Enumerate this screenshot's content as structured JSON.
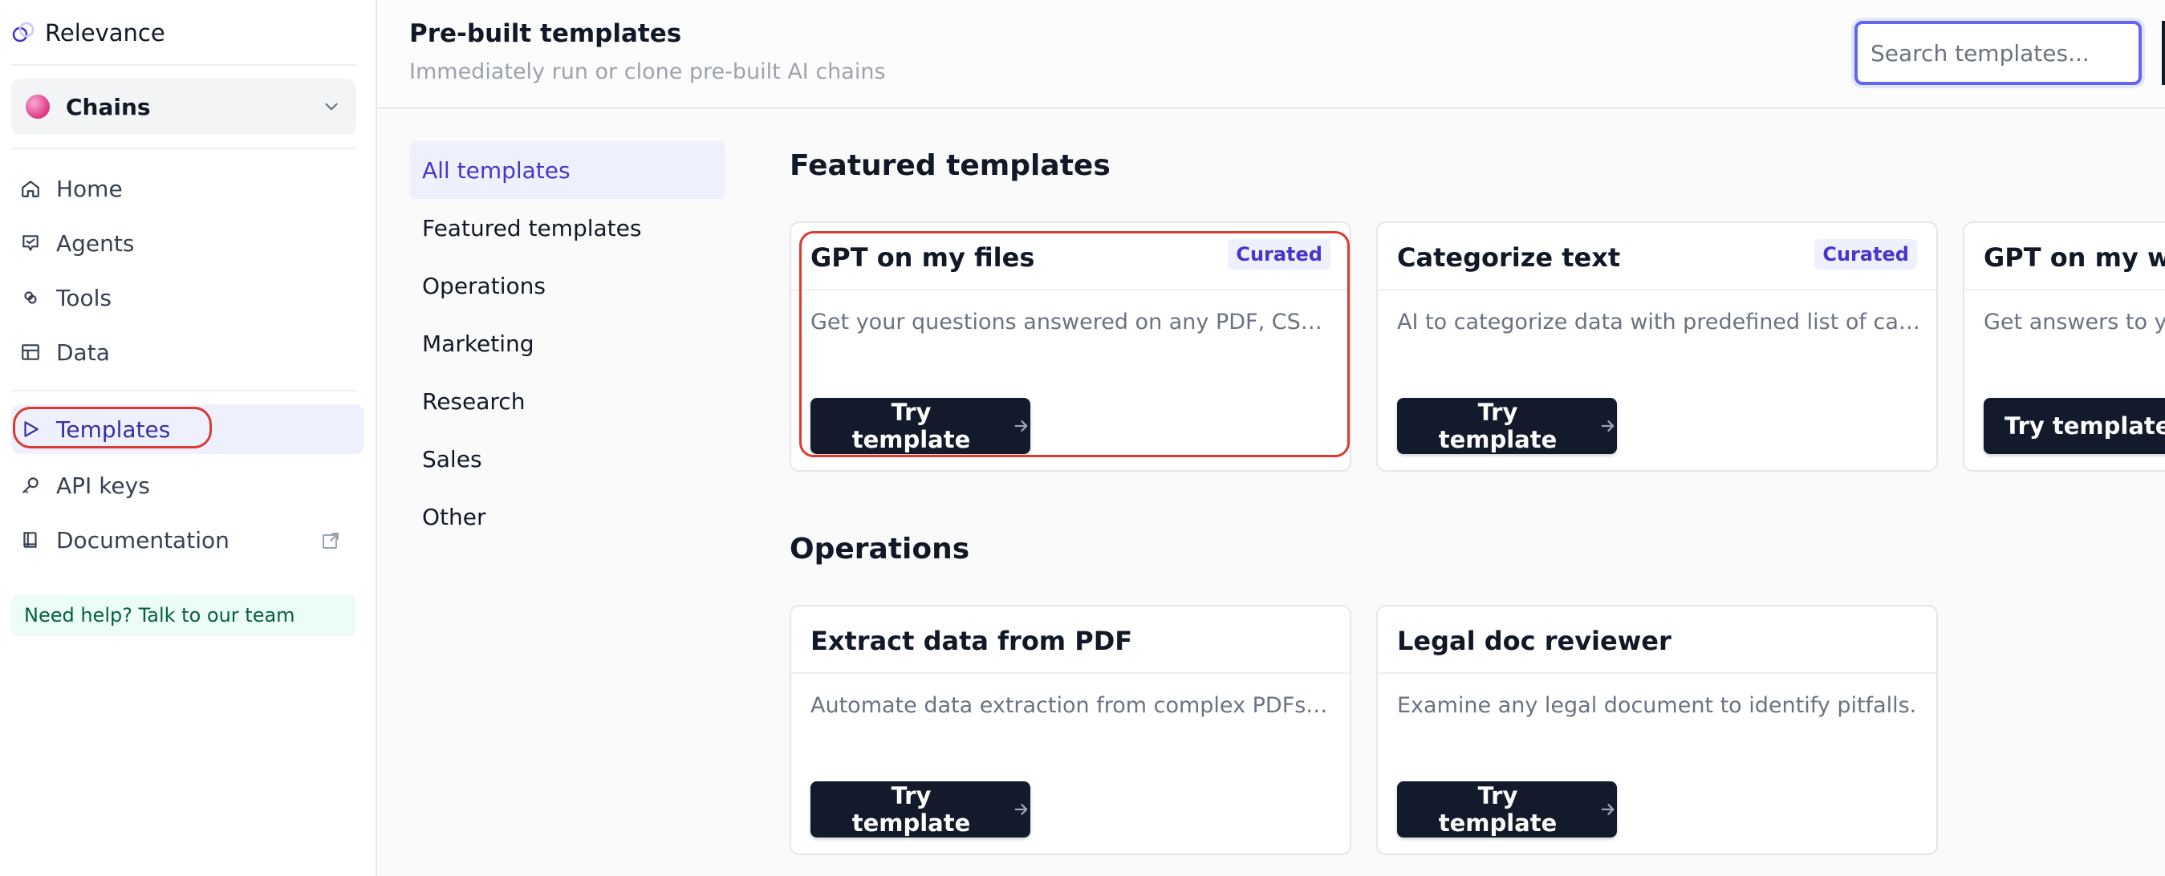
{
  "brand": {
    "name": "Relevance"
  },
  "workspace": {
    "name": "Chains"
  },
  "sidebar": {
    "items": [
      {
        "label": "Home",
        "icon": "home-icon"
      },
      {
        "label": "Agents",
        "icon": "agent-icon"
      },
      {
        "label": "Tools",
        "icon": "tools-icon"
      },
      {
        "label": "Data",
        "icon": "table-icon"
      },
      {
        "label": "Templates",
        "icon": "play-icon",
        "active": true
      },
      {
        "label": "API keys",
        "icon": "key-icon"
      },
      {
        "label": "Documentation",
        "icon": "book-icon",
        "external": true
      }
    ],
    "help": "Need help? Talk to our team"
  },
  "header": {
    "title": "Pre-built templates",
    "subtitle": "Immediately run or clone pre-built AI chains",
    "search_placeholder": "Search templates..."
  },
  "categories": [
    {
      "label": "All templates",
      "active": true
    },
    {
      "label": "Featured templates"
    },
    {
      "label": "Operations"
    },
    {
      "label": "Marketing"
    },
    {
      "label": "Research"
    },
    {
      "label": "Sales"
    },
    {
      "label": "Other"
    }
  ],
  "sections": [
    {
      "title": "Featured templates",
      "cards": [
        {
          "title": "GPT on my files",
          "badge": "Curated",
          "description": "Get your questions answered on any PDF, CSV, ...",
          "button": "Try template"
        },
        {
          "title": "Categorize text",
          "badge": "Curated",
          "description": "AI to categorize data with predefined list of cat...",
          "button": "Try template"
        },
        {
          "title": "GPT on my web",
          "badge": "",
          "description": "Get answers to yo",
          "button": "Try template"
        }
      ]
    },
    {
      "title": "Operations",
      "cards": [
        {
          "title": "Extract data from PDF",
          "badge": "",
          "description": "Automate data extraction from complex PDFs t...",
          "button": "Try template"
        },
        {
          "title": "Legal doc reviewer",
          "badge": "",
          "description": "Examine any legal document to identify pitfalls.",
          "button": "Try template"
        }
      ]
    }
  ],
  "colors": {
    "accent": "#4338ca",
    "highlight": "#dc3b2f",
    "button_bg": "#131a2b"
  }
}
